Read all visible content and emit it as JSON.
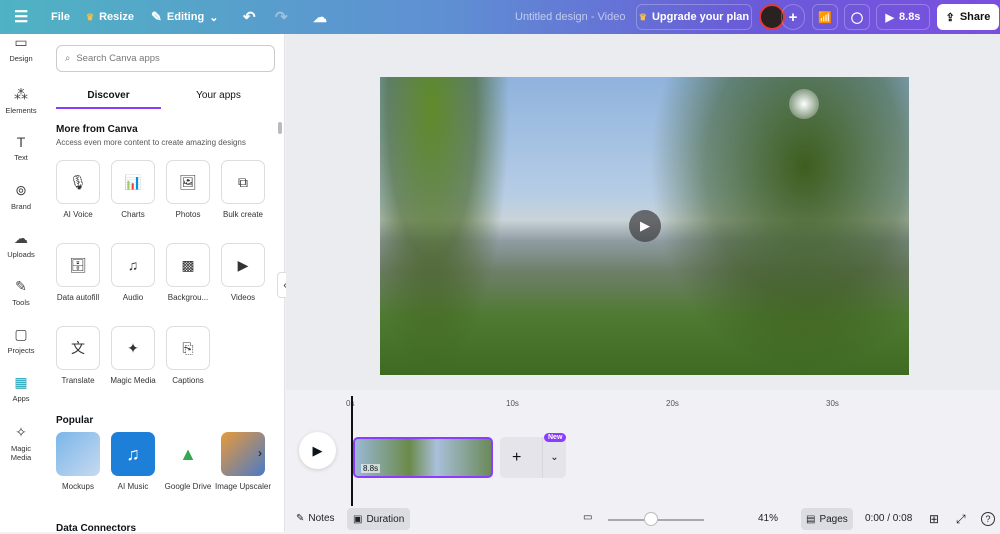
{
  "topbar": {
    "file": "File",
    "resize": "Resize",
    "editing": "Editing",
    "title": "Untitled design - Video",
    "upgrade": "Upgrade your plan",
    "play_duration": "8.8s",
    "share": "Share"
  },
  "rail": [
    {
      "label": "Design",
      "icon": "▭"
    },
    {
      "label": "Elements",
      "icon": "⁂"
    },
    {
      "label": "Text",
      "icon": "T"
    },
    {
      "label": "Brand",
      "icon": "⊚"
    },
    {
      "label": "Uploads",
      "icon": "☁"
    },
    {
      "label": "Tools",
      "icon": "✎"
    },
    {
      "label": "Projects",
      "icon": "▢"
    },
    {
      "label": "Apps",
      "icon": "▦"
    },
    {
      "label": "Magic Media",
      "icon": "✧"
    }
  ],
  "panel": {
    "search_placeholder": "Search Canva apps",
    "tabs": [
      "Discover",
      "Your apps"
    ],
    "more_title": "More from Canva",
    "more_sub": "Access even more content to create amazing designs",
    "tiles": [
      {
        "label": "AI Voice",
        "icon": "🎙"
      },
      {
        "label": "Charts",
        "icon": "📊"
      },
      {
        "label": "Photos",
        "icon": "🖼"
      },
      {
        "label": "Bulk create",
        "icon": "⧉"
      },
      {
        "label": "Data autofill",
        "icon": "🗄"
      },
      {
        "label": "Audio",
        "icon": "♫"
      },
      {
        "label": "Backgrou...",
        "icon": "▩"
      },
      {
        "label": "Videos",
        "icon": "▶"
      },
      {
        "label": "Translate",
        "icon": "文"
      },
      {
        "label": "Magic Media",
        "icon": "✦"
      },
      {
        "label": "Captions",
        "icon": "⎘"
      }
    ],
    "popular_title": "Popular",
    "popular": [
      {
        "label": "Mockups"
      },
      {
        "label": "AI Music"
      },
      {
        "label": "Google Drive"
      },
      {
        "label": "Image Upscaler"
      }
    ],
    "connectors_title": "Data Connectors"
  },
  "timeline": {
    "ticks": [
      "0s",
      "10s",
      "20s",
      "30s"
    ],
    "clip_duration": "8.8s",
    "new_badge": "New"
  },
  "bottom": {
    "notes": "Notes",
    "duration": "Duration",
    "zoom": "41%",
    "zoom_fraction": 0.35,
    "pages": "Pages",
    "time": "0:00 / 0:08"
  }
}
